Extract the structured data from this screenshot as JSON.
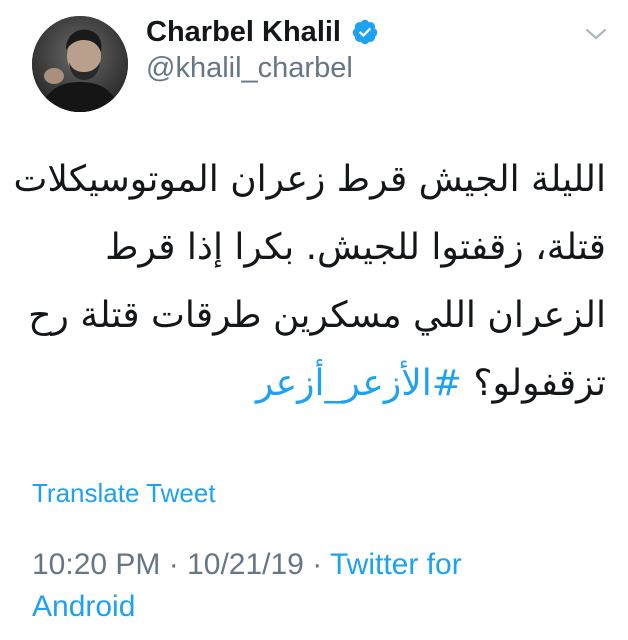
{
  "user": {
    "display_name": "Charbel Khalil",
    "handle": "@khalil_charbel",
    "verified": true
  },
  "tweet": {
    "lines": [
      "الليلة الجيش قرط زعران الموتوسيكلات",
      "قتلة، زقفتوا للجيش. بكرا إذا قرط",
      "الزعران اللي مسكرين طرقات قتلة رح"
    ],
    "last_line_text": "تزقفولو؟",
    "hashtag": "#الأزعر_أزعر"
  },
  "translate_label": "Translate Tweet",
  "meta": {
    "time": "10:20 PM",
    "separator": " · ",
    "date": "10/21/19",
    "source": "Twitter for Android"
  },
  "colors": {
    "link": "#1da1f2",
    "secondary_text": "#657786",
    "primary_text": "#14171a"
  },
  "icons": {
    "verified": "verified-badge-icon",
    "menu": "chevron-down-icon"
  }
}
